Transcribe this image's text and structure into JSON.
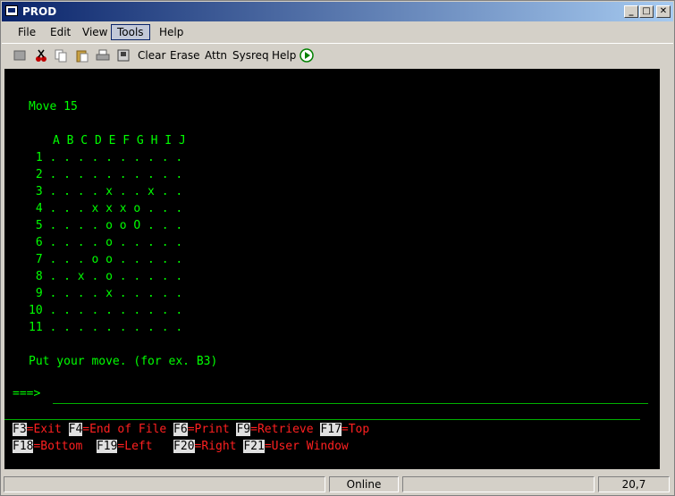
{
  "window": {
    "title": "PROD"
  },
  "menu": {
    "file": "File",
    "edit": "Edit",
    "view": "View",
    "tools": "Tools",
    "help": "Help"
  },
  "toolbar": {
    "clear": "Clear",
    "erase": "Erase",
    "attn": "Attn",
    "sysreq": "Sysreq",
    "help": "Help"
  },
  "terminal": {
    "move_line": "Move 15",
    "header": "A B C D E F G H I J",
    "rows": [
      " 1 . . . . . . . . . .",
      " 2 . . . . . . . . . .",
      " 3 . . . . x . . x . .",
      " 4 . . . x x x o . . .",
      " 5 . . . . o o O . . .",
      " 6 . . . . o . . . . .",
      " 7 . . . o o . . . . .",
      " 8 . . x . o . . . . .",
      " 9 . . . . x . . . . .",
      "10 . . . . . . . . . .",
      "11 . . . . . . . . . ."
    ],
    "prompt": "Put your move. (for ex. B3)",
    "input_prompt": "===>",
    "input_value": "",
    "fkeys_row1": [
      {
        "key": "F3",
        "label": "=Exit"
      },
      {
        "key": "F4",
        "label": "=End of File"
      },
      {
        "key": "F6",
        "label": "=Print"
      },
      {
        "key": "F9",
        "label": "=Retrieve"
      },
      {
        "key": "F17",
        "label": "=Top"
      }
    ],
    "fkeys_row2": [
      {
        "key": "F18",
        "label": "=Bottom"
      },
      {
        "key": "F19",
        "label": "=Left"
      },
      {
        "key": "F20",
        "label": "=Right"
      },
      {
        "key": "F21",
        "label": "=User Window"
      }
    ]
  },
  "status": {
    "connection": "Online",
    "cursor": "20,7"
  }
}
